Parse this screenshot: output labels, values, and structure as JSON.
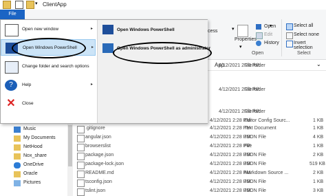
{
  "window": {
    "title": "ClientApp"
  },
  "file_tab": "File",
  "file_menu": {
    "items": [
      {
        "label": "Open new window",
        "arrow": "▸"
      },
      {
        "label": "Open Windows PowerShell",
        "arrow": "▸"
      },
      {
        "label": "Change folder and search options",
        "arrow": ""
      },
      {
        "label": "Help",
        "arrow": "▸"
      },
      {
        "label": "Close",
        "arrow": ""
      }
    ],
    "powershell": [
      {
        "label": "Open Windows PowerShell"
      },
      {
        "label": "Open Windows PowerShell as administrator"
      }
    ]
  },
  "ribbon": {
    "properties": "Properties",
    "open_label": "Open",
    "edit_label": "Edit",
    "history_label": "History",
    "group_open": "Open",
    "select_all": "Select all",
    "select_none": "Select none",
    "invert_selection": "Invert selection",
    "group_select": "Select",
    "access_fragment": "cess",
    "app_fragment": "App"
  },
  "nav_items": [
    "Music",
    "My Documents",
    "NetHood",
    "Nox_share",
    "OneDrive",
    "Oracle",
    "Pictures"
  ],
  "files": [
    {
      "name": "",
      "date": "4/12/2021 2:28 PM",
      "type": "File folder",
      "size": ""
    },
    {
      "name": "",
      "date": "4/12/2021 2:28 PM",
      "type": "File folder",
      "size": ""
    },
    {
      "name": "",
      "date": "4/12/2021 2:28 PM",
      "type": "File folder",
      "size": ""
    },
    {
      "name": "",
      "date": "4/12/2021 2:28 PM",
      "type": "Editor Config Sourc...",
      "size": "1 KB"
    },
    {
      "name": ".gitignore",
      "date": "4/12/2021 2:28 PM",
      "type": "Text Document",
      "size": "1 KB"
    },
    {
      "name": "angular.json",
      "date": "4/12/2021 2:28 PM",
      "type": "JSON File",
      "size": "4 KB"
    },
    {
      "name": "browserslist",
      "date": "4/12/2021 2:28 PM",
      "type": "File",
      "size": "1 KB"
    },
    {
      "name": "package.json",
      "date": "4/12/2021 2:28 PM",
      "type": "JSON File",
      "size": "2 KB"
    },
    {
      "name": "package-lock.json",
      "date": "4/12/2021 2:28 PM",
      "type": "JSON File",
      "size": "519 KB"
    },
    {
      "name": "README.md",
      "date": "4/12/2021 2:28 PM",
      "type": "Markdown Source ...",
      "size": "2 KB"
    },
    {
      "name": "tsconfig.json",
      "date": "4/12/2021 2:28 PM",
      "type": "JSON File",
      "size": "1 KB"
    },
    {
      "name": "tslint.json",
      "date": "4/12/2021 2:28 PM",
      "type": "JSON File",
      "size": "3 KB"
    }
  ]
}
